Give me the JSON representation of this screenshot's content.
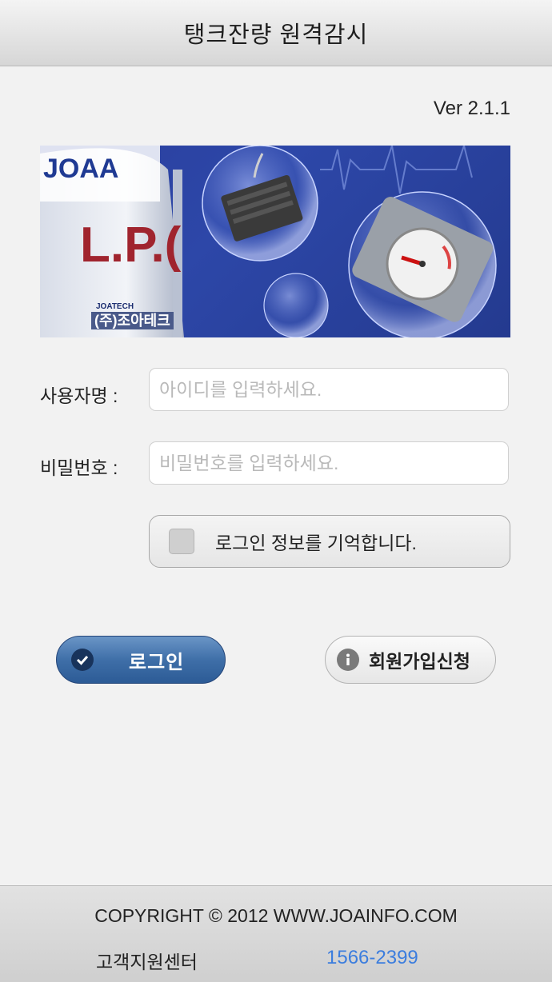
{
  "header": {
    "title": "탱크잔량 원격감시"
  },
  "version": "Ver 2.1.1",
  "banner": {
    "tank_text": "L.P.(",
    "logo_text": "JOAA",
    "logo_sub": "JOATECH",
    "logo_corp": "(주)조아테크"
  },
  "form": {
    "username_label": "사용자명 :",
    "username_placeholder": "아이디를 입력하세요.",
    "username_value": "",
    "password_label": "비밀번호 :",
    "password_placeholder": "비밀번호를 입력하세요.",
    "password_value": "",
    "remember_label": "로그인 정보를 기억합니다.",
    "remember_checked": false
  },
  "buttons": {
    "login_label": "로그인",
    "join_label": "회원가입신청"
  },
  "footer": {
    "copyright": "COPYRIGHT © 2012 WWW.JOAINFO.COM",
    "support_label": "고객지원센터",
    "support_phone": "1566-2399"
  },
  "colors": {
    "accent_blue": "#3f6fa8",
    "link_blue": "#3b7dde",
    "banner_bg": "#2d47a8"
  }
}
